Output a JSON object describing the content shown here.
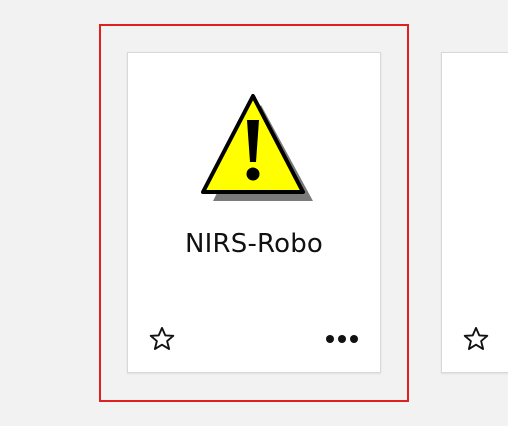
{
  "tiles": [
    {
      "name": "NIRS-Robo",
      "icon": "warning-icon",
      "favorite_icon": "star-outline-icon",
      "menu_icon": "more-icon",
      "selected": true
    },
    {
      "name": "",
      "favorite_icon": "star-outline-icon"
    }
  ],
  "colors": {
    "background": "#f2f2f2",
    "selection_border": "#e0201f",
    "card": "#ffffff",
    "warning_fill": "#ffff00",
    "warning_outline": "#000000",
    "warning_shadow": "#7a7a7a"
  }
}
